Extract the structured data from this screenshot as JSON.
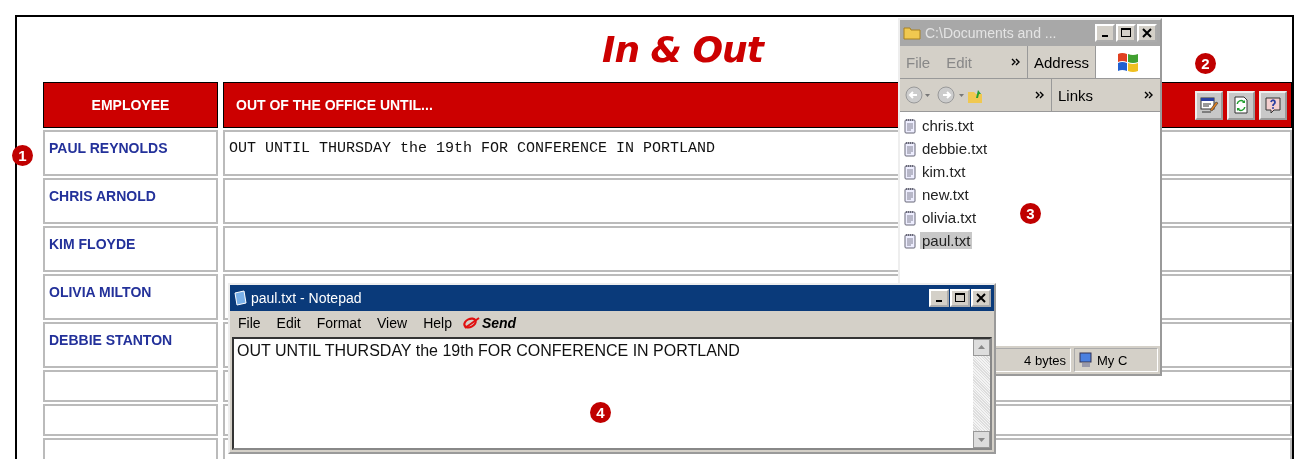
{
  "page": {
    "title": "In & Out"
  },
  "table": {
    "columns": [
      "EMPLOYEE",
      "OUT OF THE OFFICE UNTIL..."
    ],
    "rows": [
      {
        "kind": "entry",
        "employee": "PAUL REYNOLDS",
        "status": "OUT UNTIL THURSDAY the 19th FOR CONFERENCE IN PORTLAND"
      },
      {
        "kind": "entry",
        "employee": "CHRIS ARNOLD"
      },
      {
        "kind": "entry",
        "employee": "KIM FLOYDE"
      },
      {
        "kind": "entry",
        "employee": "OLIVIA MILTON"
      },
      {
        "kind": "entry",
        "employee": "DEBBIE STANTON"
      },
      {
        "kind": "blank"
      },
      {
        "kind": "blank"
      },
      {
        "kind": "blank"
      }
    ]
  },
  "explorer": {
    "title": "C:\\Documents and ...",
    "active": false,
    "menu": [
      "File",
      "Edit"
    ],
    "address_label": "Address",
    "links_label": "Links",
    "files": [
      {
        "name": "chris.txt",
        "selected": false
      },
      {
        "name": "debbie.txt",
        "selected": false
      },
      {
        "name": "kim.txt",
        "selected": false
      },
      {
        "name": "new.txt",
        "selected": false
      },
      {
        "name": "olivia.txt",
        "selected": false
      },
      {
        "name": "paul.txt",
        "selected": true
      }
    ],
    "status": [
      "4 bytes",
      "My C"
    ]
  },
  "notepad": {
    "title": "paul.txt - Notepad",
    "active": true,
    "menu": [
      "File",
      "Edit",
      "Format",
      "View",
      "Help"
    ],
    "send_label": "Send",
    "text": "OUT UNTIL THURSDAY the 19th FOR CONFERENCE IN PORTLAND"
  },
  "callouts": [
    "1",
    "2",
    "3",
    "4"
  ]
}
